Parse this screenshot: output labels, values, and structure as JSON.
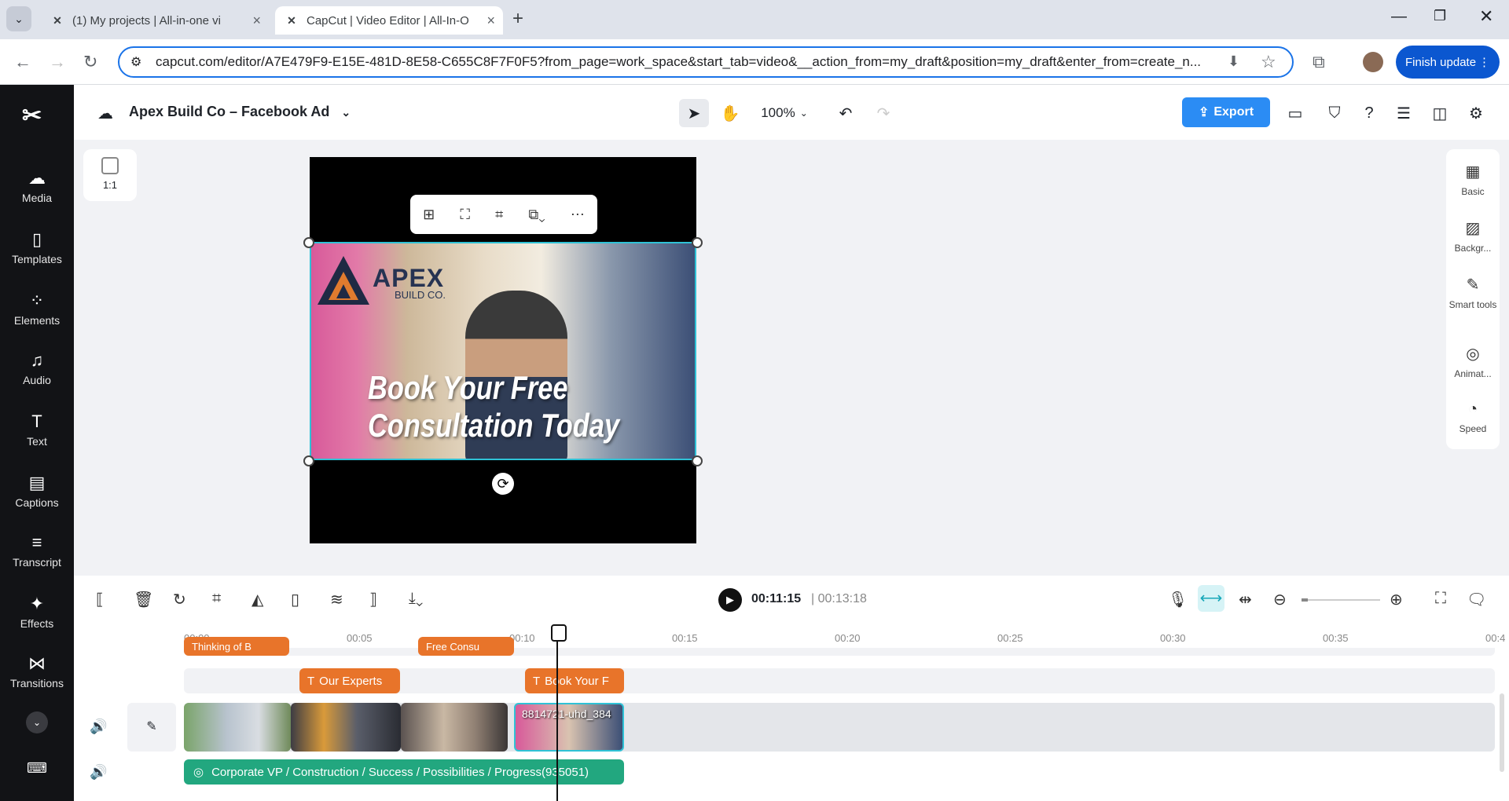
{
  "browser": {
    "tabs": [
      {
        "title": "(1)  My projects | All-in-one vi"
      },
      {
        "title": "CapCut | Video Editor | All-In-O"
      }
    ],
    "url": "capcut.com/editor/A7E479F9-E15E-481D-8E58-C655C8F7F0F5?from_page=work_space&start_tab=video&__action_from=my_draft&position=my_draft&enter_from=create_n...",
    "finish_update": "Finish update"
  },
  "sidebar": {
    "items": [
      {
        "label": "Media",
        "icon": "cloud-upload-icon"
      },
      {
        "label": "Templates",
        "icon": "templates-icon"
      },
      {
        "label": "Elements",
        "icon": "elements-icon"
      },
      {
        "label": "Audio",
        "icon": "music-note-icon"
      },
      {
        "label": "Text",
        "icon": "text-icon"
      },
      {
        "label": "Captions",
        "icon": "captions-icon"
      },
      {
        "label": "Transcript",
        "icon": "transcript-icon"
      },
      {
        "label": "Effects",
        "icon": "effects-icon"
      },
      {
        "label": "Transitions",
        "icon": "transitions-icon"
      }
    ]
  },
  "topbar": {
    "project_name": "Apex Build Co – Facebook Ad",
    "zoom": "100%",
    "export_label": "Export"
  },
  "canvas": {
    "ratio_label": "1:1",
    "logo_text": "APEX",
    "logo_sub": "BUILD CO.",
    "headline_line1": "Book Your Free",
    "headline_line2": "Consultation Today"
  },
  "right_panel": {
    "items": [
      {
        "label": "Basic",
        "icon": "basic-icon"
      },
      {
        "label": "Backgr...",
        "icon": "background-icon"
      },
      {
        "label": "Smart tools",
        "icon": "magic-wand-icon"
      },
      {
        "label": "Animat...",
        "icon": "animation-icon"
      },
      {
        "label": "Speed",
        "icon": "speed-icon"
      }
    ]
  },
  "timeline": {
    "current_time": "00:11:15",
    "duration": "00:13:18",
    "ruler": [
      "00:00",
      "00:05",
      "00:10",
      "00:15",
      "00:20",
      "00:25",
      "00:30",
      "00:35",
      "00:4"
    ],
    "text_clips_row1": [
      "Thinking of B",
      "Free Consu"
    ],
    "text_clips_row2": [
      "Our Experts",
      "Book Your F"
    ],
    "video_clip_label": "8814721-uhd_384",
    "audio_clip_label": "Corporate VP / Construction / Success / Possibilities / Progress(935051)"
  }
}
